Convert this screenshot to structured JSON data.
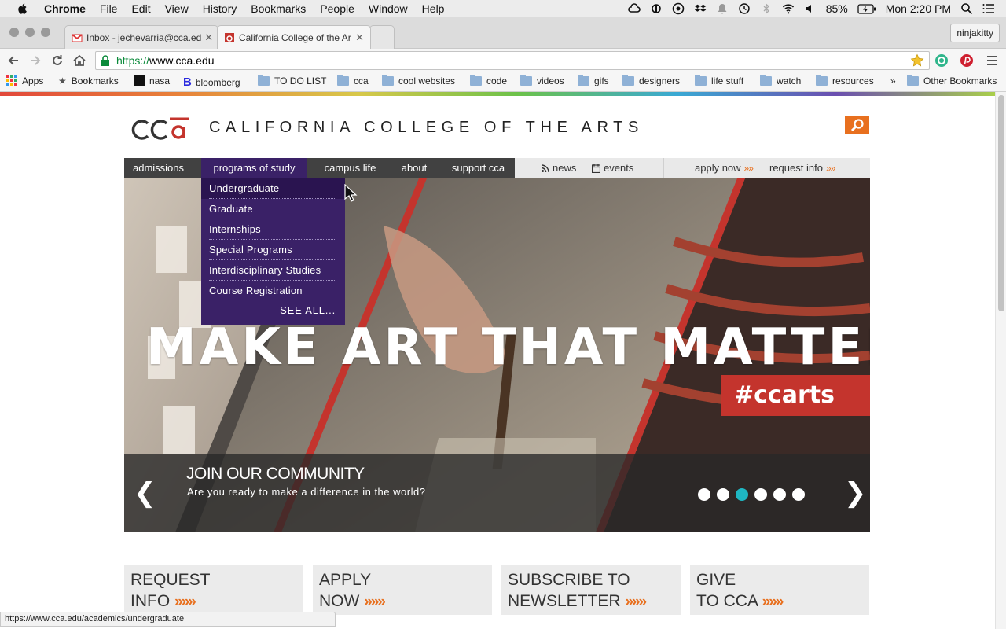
{
  "menubar": {
    "app": "Chrome",
    "items": [
      "File",
      "Edit",
      "View",
      "History",
      "Bookmarks",
      "People",
      "Window",
      "Help"
    ],
    "battery": "85%",
    "clock": "Mon 2:20 PM"
  },
  "tabs": [
    {
      "title": "Inbox - jechevarria@cca.ed"
    },
    {
      "title": "California College of the Ar"
    }
  ],
  "profile": "ninjakitty",
  "address": {
    "scheme": "https://",
    "host": "www.cca.edu"
  },
  "bookmarks": [
    "Apps",
    "Bookmarks",
    "nasa",
    "bloomberg",
    "TO DO LIST",
    "cca",
    "cool websites",
    "code",
    "videos",
    "gifs",
    "designers",
    "life stuff",
    "watch",
    "resources",
    "»",
    "Other Bookmarks"
  ],
  "site": {
    "title": "CALIFORNIA COLLEGE OF THE ARTS",
    "nav": [
      "admissions",
      "programs of study",
      "campus life",
      "about",
      "support cca"
    ],
    "nav_right": [
      "news",
      "events",
      "apply now",
      "request info"
    ],
    "chevrons": "»»",
    "dropdown": [
      "Undergraduate",
      "Graduate",
      "Internships",
      "Special Programs",
      "Interdisciplinary Studies",
      "Course Registration"
    ],
    "see_all": "SEE ALL...",
    "hero": {
      "headline": "MAKE ART THAT MATTERS",
      "hashtag": "#ccarts",
      "caption_title": "JOIN OUR COMMUNITY",
      "caption_sub": "Are you ready to make a difference in the world?",
      "prev": "❮",
      "next": "❯",
      "slide_count": 6,
      "active_slide": 3
    },
    "cta": [
      {
        "line1": "REQUEST",
        "line2": "INFO"
      },
      {
        "line1": "APPLY",
        "line2": "NOW"
      },
      {
        "line1": "SUBSCRIBE TO",
        "line2": "NEWSLETTER"
      },
      {
        "line1": "GIVE",
        "line2": "TO CCA"
      }
    ],
    "cta_chevrons": "»»»"
  },
  "status_url": "https://www.cca.edu/academics/undergraduate",
  "colors": {
    "accent": "#e8701f",
    "nav_active": "#3a2167",
    "nav_bg": "#414141",
    "slide_active": "#1fb7c3",
    "hashtag_bg": "#c4342d"
  }
}
